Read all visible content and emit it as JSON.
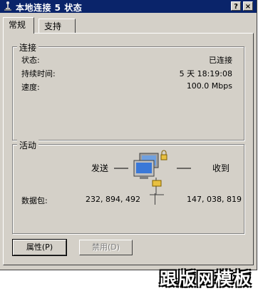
{
  "window": {
    "title": "本地连接 5 状态",
    "help_label": "?",
    "close_label": "×"
  },
  "tabs": [
    {
      "label": "常规",
      "active": true
    },
    {
      "label": "支持",
      "active": false
    }
  ],
  "connection": {
    "group_title": "连接",
    "rows": [
      {
        "label": "状态:",
        "value": "已连接"
      },
      {
        "label": "持续时间:",
        "value": "5 天 18:19:08"
      },
      {
        "label": "速度:",
        "value": "100.0 Mbps"
      }
    ]
  },
  "activity": {
    "group_title": "活动",
    "sent_label": "发送",
    "received_label": "收到",
    "packets_label": "数据包:",
    "packets_sent": "232, 894, 492",
    "packets_received": "147, 038, 819",
    "icon": "network-computers-icon"
  },
  "buttons": {
    "properties": "属性(P)",
    "disable": "禁用(D)"
  },
  "watermark": "跟版网模板",
  "colors": {
    "titlebar": "#0a246a",
    "face": "#d4d0c8"
  }
}
